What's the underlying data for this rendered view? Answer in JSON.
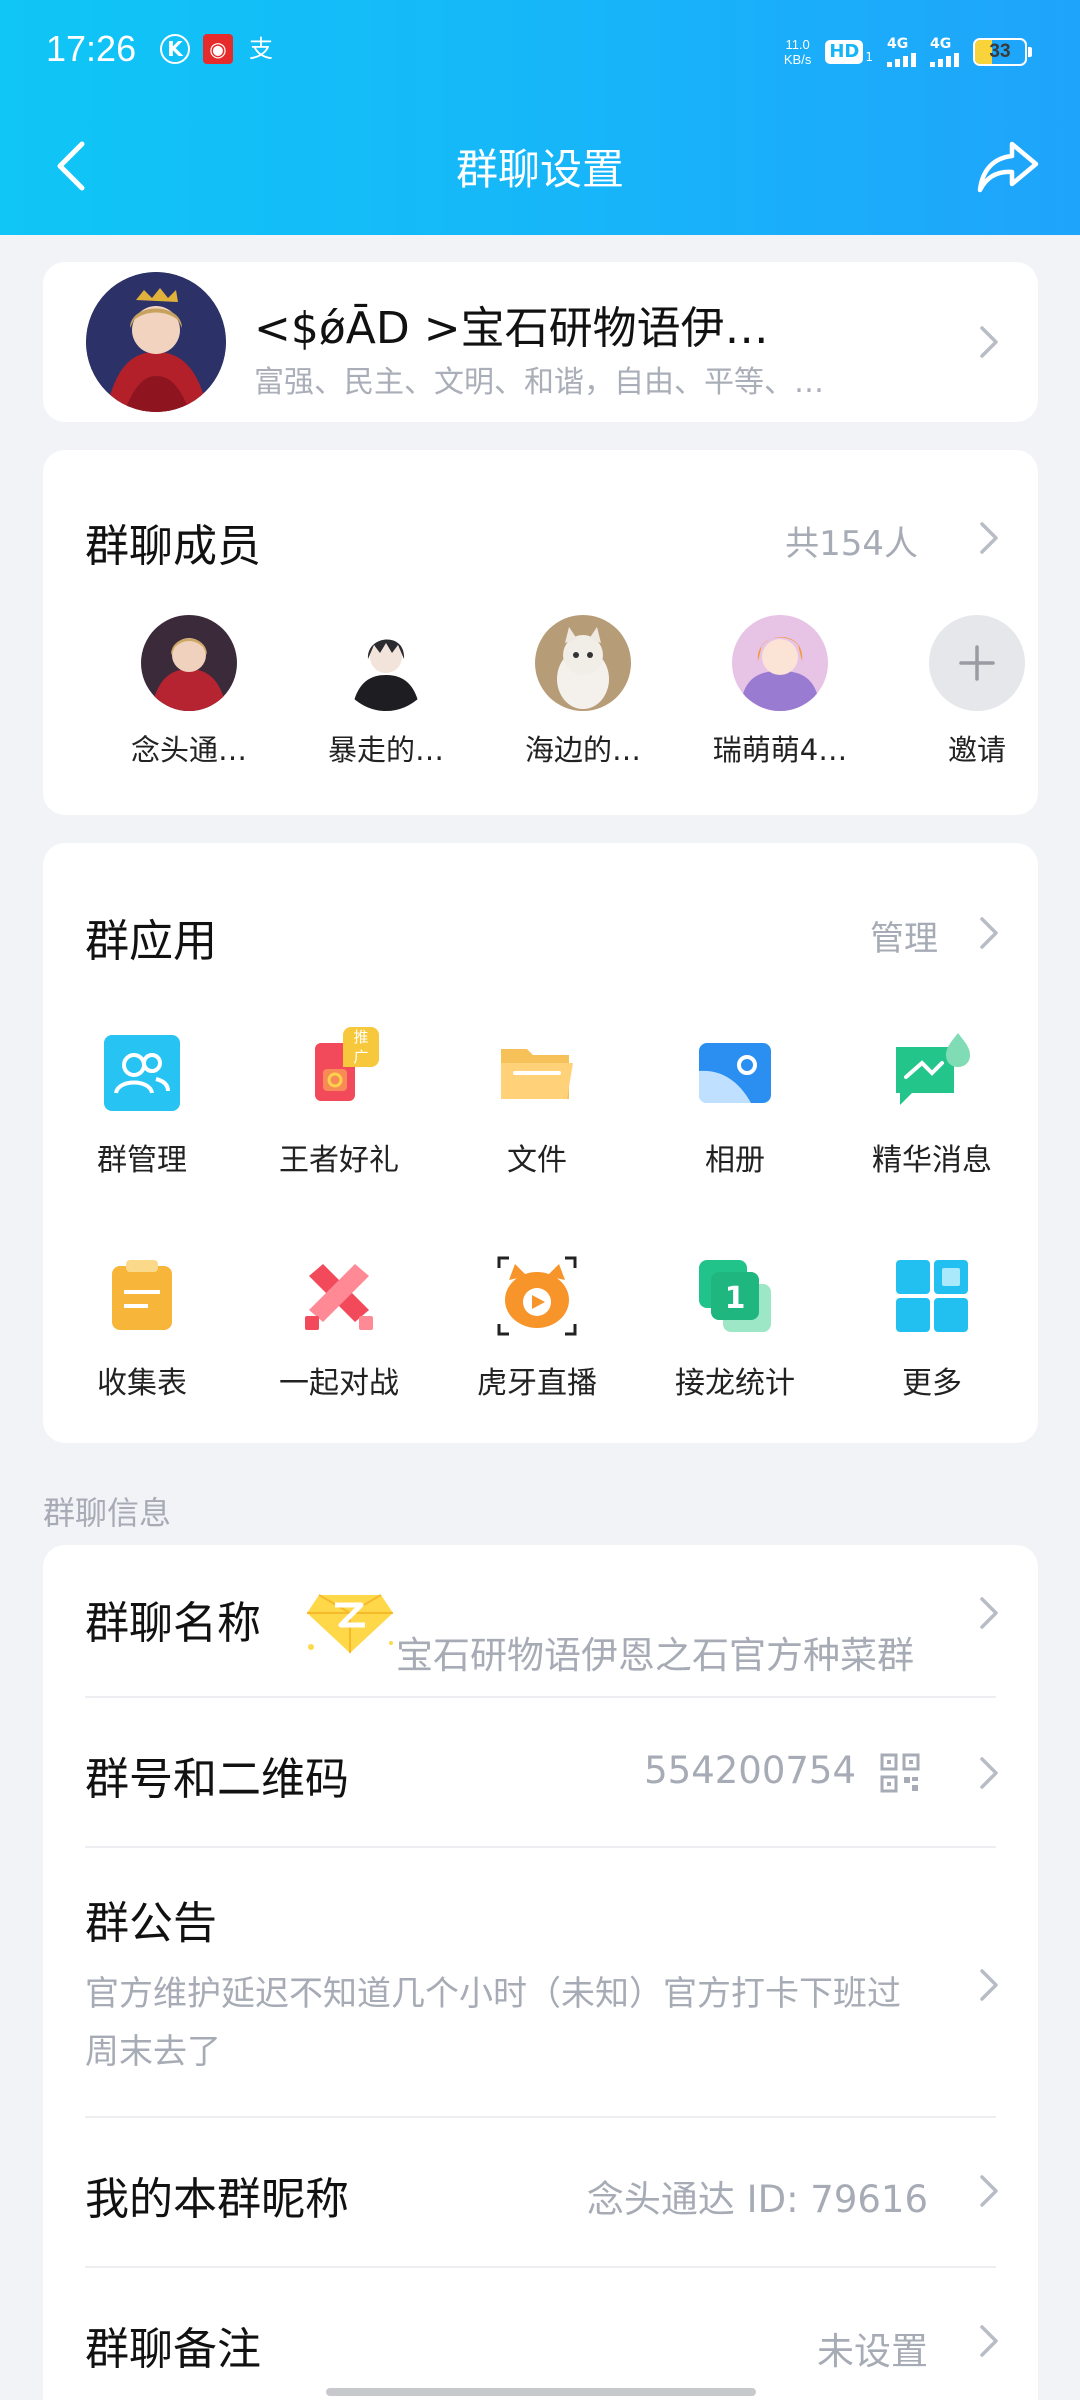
{
  "status_bar": {
    "time": "17:26",
    "net_speed_value": "11.0",
    "net_speed_unit": "KB/s",
    "hd_label": "HD",
    "hd_sub": "1",
    "signal1": "4G",
    "signal2": "4G",
    "battery": "33",
    "battery_level": 0.33
  },
  "nav": {
    "title": "群聊设置"
  },
  "group": {
    "name": "<$ǿĀD >宝石研物语伊…",
    "desc": "富强、民主、文明、和谐，自由、平等、…"
  },
  "members": {
    "title": "群聊成员",
    "count": "共154人",
    "items": [
      {
        "name": "念头通…"
      },
      {
        "name": "暴走的…"
      },
      {
        "name": "海边的…"
      },
      {
        "name": "瑞萌萌4…"
      }
    ],
    "invite": "邀请"
  },
  "apps": {
    "title": "群应用",
    "manage": "管理",
    "badge_promo": "推广",
    "items": [
      {
        "label": "群管理",
        "icon": "group-manage-icon"
      },
      {
        "label": "王者好礼",
        "icon": "gift-icon"
      },
      {
        "label": "文件",
        "icon": "folder-icon"
      },
      {
        "label": "相册",
        "icon": "album-icon"
      },
      {
        "label": "精华消息",
        "icon": "essence-message-icon"
      },
      {
        "label": "收集表",
        "icon": "clipboard-icon"
      },
      {
        "label": "一起对战",
        "icon": "battle-icon"
      },
      {
        "label": "虎牙直播",
        "icon": "huya-live-icon"
      },
      {
        "label": "接龙统计",
        "icon": "solitaire-icon"
      },
      {
        "label": "更多",
        "icon": "more-grid-icon"
      }
    ]
  },
  "info": {
    "caption": "群聊信息",
    "name_title": "群聊名称",
    "name_value": "宝石研物语伊恩之石官方种菜群",
    "number_title": "群号和二维码",
    "number_value": "554200754",
    "notice_title": "群公告",
    "notice_value": "官方维护延迟不知道几个小时（未知）官方打卡下班过周末去了",
    "nickname_title": "我的本群昵称",
    "nickname_value": "念头通达 ID: 79616",
    "remark_title": "群聊备注",
    "remark_value": "未设置"
  },
  "colors": {
    "header_gradient_start": "#0fc6f6",
    "header_gradient_end": "#1fa4fb",
    "background": "#f2f3f7",
    "muted_text": "#a6abb5"
  }
}
